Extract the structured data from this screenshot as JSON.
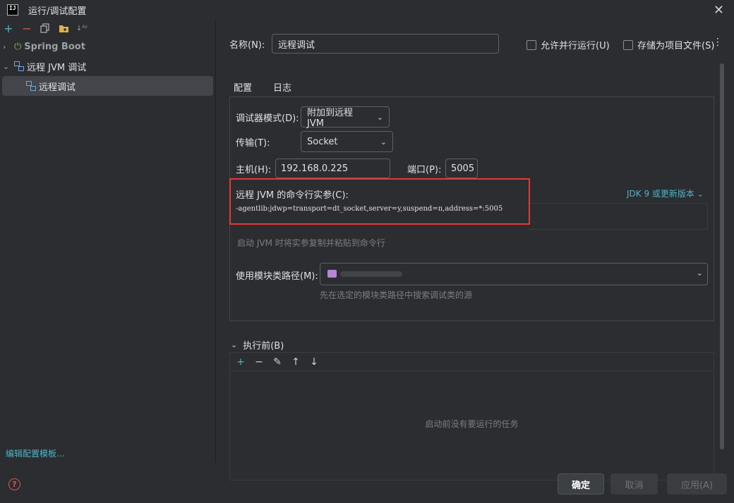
{
  "window": {
    "title": "运行/调试配置",
    "app_icon_text": "IJ"
  },
  "colors": {
    "accent": "#3574f0",
    "link": "#4eb3c7",
    "highlight_box": "#e53935",
    "folder": "#b784d9"
  },
  "toolbar": {
    "icons": [
      "add-icon",
      "remove-icon",
      "copy-icon",
      "folder-add-icon",
      "sort-icon"
    ]
  },
  "tree": {
    "spring_boot": "Spring Boot",
    "remote_jvm": "远程 JVM 调试",
    "selected_item": "远程调试"
  },
  "edit_templates": "编辑配置模板...",
  "name": {
    "label": "名称(N):",
    "value": "远程调试"
  },
  "options": {
    "allow_parallel": "允许并行运行(U)",
    "store_as_file": "存储为项目文件(S)"
  },
  "tabs": [
    "配置",
    "日志"
  ],
  "config": {
    "debugger_mode_label": "调试器模式(D):",
    "debugger_mode_value": "附加到远程 JVM",
    "transport_label": "传输(T):",
    "transport_value": "Socket",
    "host_label": "主机(H):",
    "host_value": "192.168.0.225",
    "port_label": "端口(P):",
    "port_value": "5005",
    "cmd_label": "远程 JVM 的命令行实参(C):",
    "cmd_value": "-agentlib:jdwp=transport=dt_socket,server=y,suspend=n,address=*:5005",
    "jdk_link": "JDK 9 或更新版本",
    "cmd_hint": "启动 JVM 时将实参复制并粘贴到命令行",
    "module_label": "使用模块类路径(M):",
    "module_hint": "先在选定的模块类路径中搜索调试类的源"
  },
  "before_launch": {
    "label": "执行前(B)",
    "empty": "启动前没有要运行的任务"
  },
  "buttons": {
    "ok": "确定",
    "cancel": "取消",
    "apply": "应用(A)"
  }
}
